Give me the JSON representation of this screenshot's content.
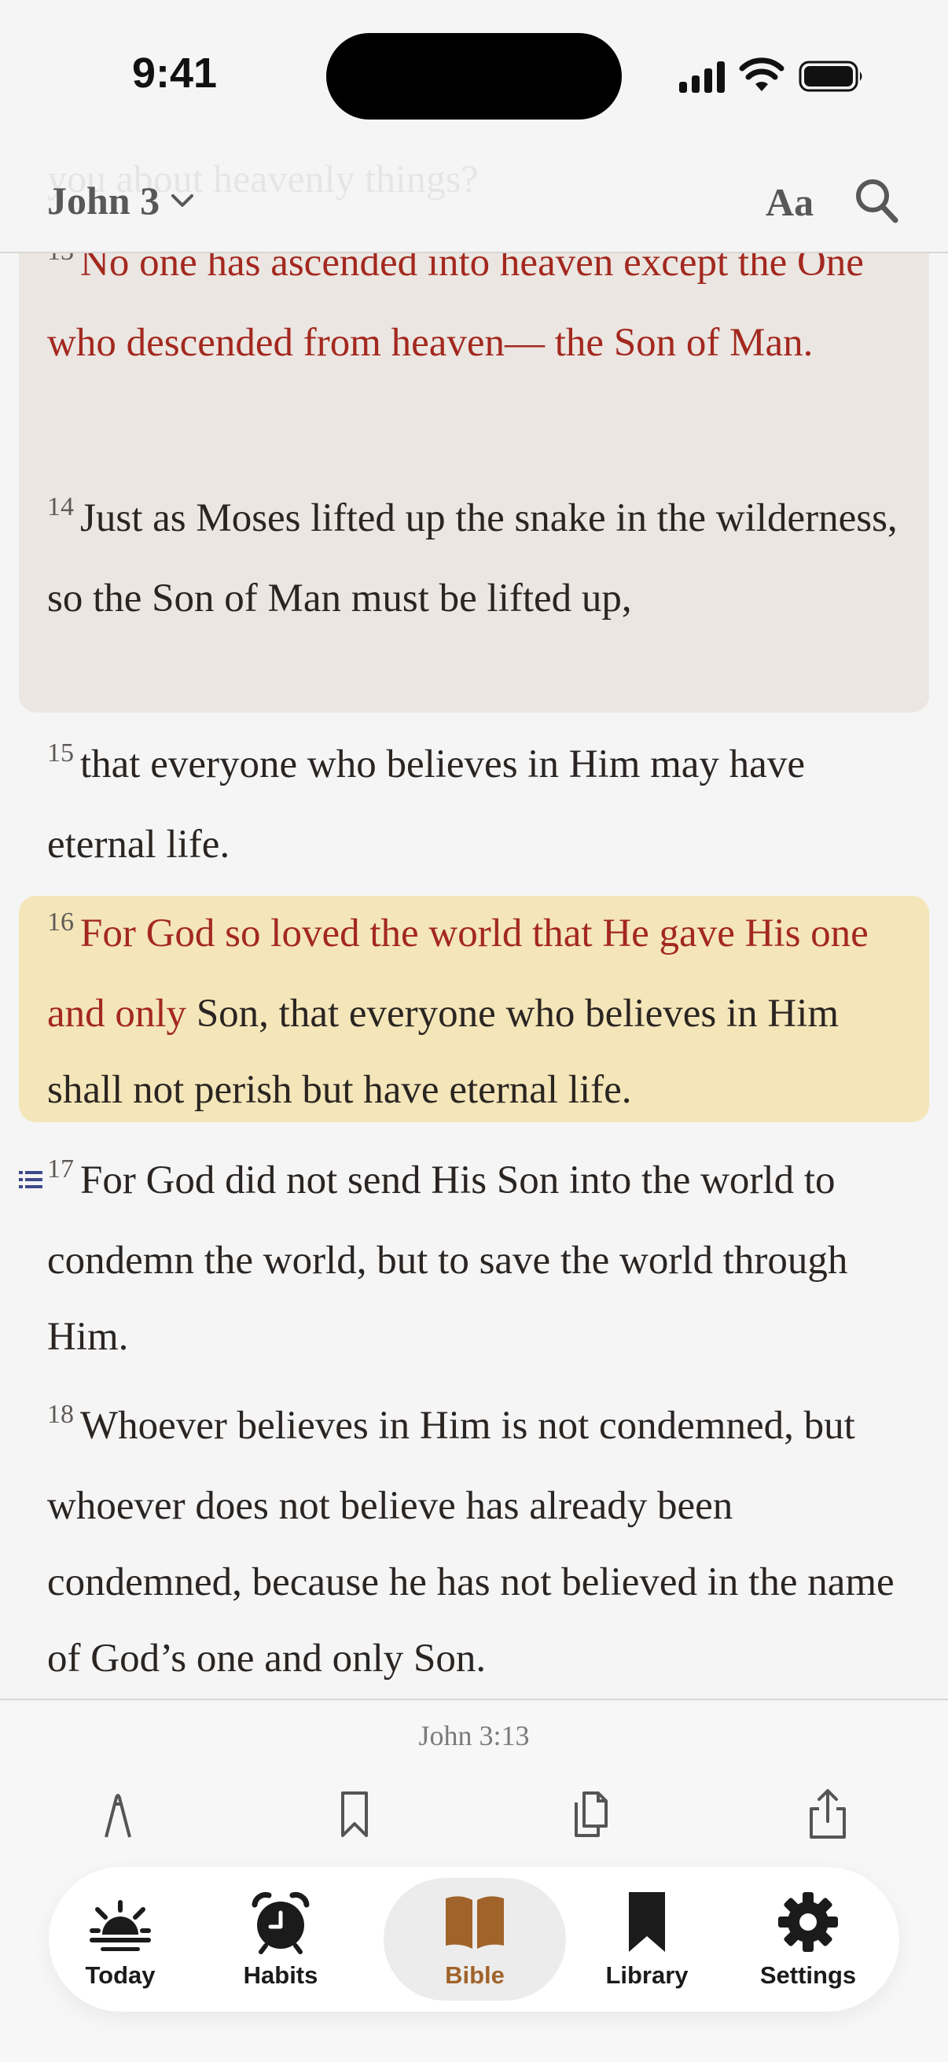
{
  "status": {
    "time": "9:41"
  },
  "header": {
    "faded_text": "you about heavenly things?",
    "book": "John 3",
    "aa": "Aa"
  },
  "verses": [
    {
      "num": "13",
      "text": "No one has ascended into heaven except the One who descended from heaven— the Son of Man."
    },
    {
      "num": "14",
      "text": "Just as Moses lifted up the snake in the wilderness, so the Son of Man must be lifted up,"
    },
    {
      "num": "15",
      "text": "that everyone who believes in Him may have eternal life."
    },
    {
      "num": "16",
      "red": "For God so loved the world that He gave His one and only",
      "text": " Son, that everyone who believes in Him shall not perish but have eternal life."
    },
    {
      "num": "17",
      "text": "For God did not send His Son into the world to condemn the world, but to save the world through Him."
    },
    {
      "num": "18",
      "text": "Whoever believes in Him is not condemned, but whoever does not believe has already been condemned, because he has not believed in the name of God’s one and only Son."
    }
  ],
  "action_bar": {
    "reference": "John 3:13",
    "actions": [
      "highlight-icon",
      "bookmark-icon",
      "copy-icon",
      "share-icon"
    ]
  },
  "tabs": [
    {
      "label": "Today",
      "icon": "sunrise-icon"
    },
    {
      "label": "Habits",
      "icon": "alarm-clock-icon"
    },
    {
      "label": "Bible",
      "icon": "open-book-icon",
      "active": true
    },
    {
      "label": "Library",
      "icon": "bookmark-icon"
    },
    {
      "label": "Settings",
      "icon": "gear-icon"
    }
  ],
  "colors": {
    "red_letter": "#a3281f",
    "highlight_yellow": "#f4e6b9",
    "selected_verse": "#ebe6e1",
    "accent": "#a0632a"
  }
}
